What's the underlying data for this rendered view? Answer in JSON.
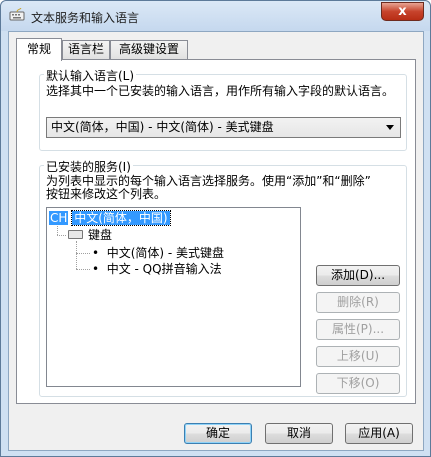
{
  "window": {
    "title": "文本服务和输入语言",
    "close_label": "x"
  },
  "tabs": [
    {
      "label": "常规"
    },
    {
      "label": "语言栏"
    },
    {
      "label": "高级键设置"
    }
  ],
  "default_language": {
    "group_title": "默认输入语言(L)",
    "description": "选择其中一个已安装的输入语言，用作所有输入字段的默认语言。",
    "selected": "中文(简体，中国) - 中文(简体) - 美式键盘"
  },
  "installed_services": {
    "group_title": "已安装的服务(I)",
    "description_line1": "为列表中显示的每个输入语言选择服务。使用“添加”和“删除”",
    "description_line2": "按钮来修改这个列表。",
    "tree": {
      "language_code": "CH",
      "language": "中文(简体，中国)",
      "category": "键盘",
      "items": [
        "中文(简体) - 美式键盘",
        "中文 - QQ拼音输入法"
      ]
    },
    "buttons": {
      "add": "添加(D)...",
      "remove": "删除(R)",
      "properties": "属性(P)...",
      "move_up": "上移(U)",
      "move_down": "下移(O)"
    }
  },
  "footer": {
    "ok": "确定",
    "cancel": "取消",
    "apply": "应用(A)"
  }
}
